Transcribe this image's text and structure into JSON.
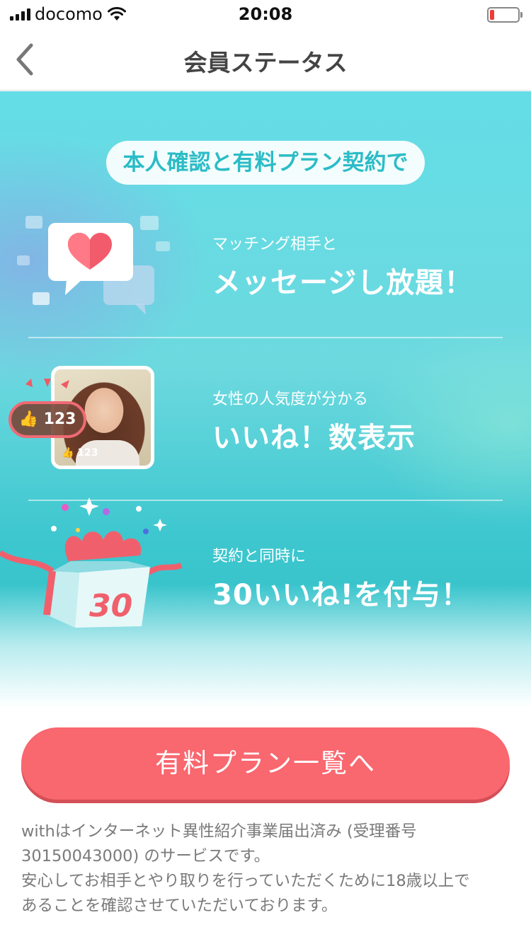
{
  "status_bar": {
    "carrier": "docomo",
    "time": "20:08",
    "battery_level": 0.15,
    "battery_color": "#f03b36"
  },
  "nav": {
    "title": "会員ステータス",
    "back_icon": "chevron-left-icon"
  },
  "hero": {
    "headline": "本人確認と有料プラン契約で",
    "features": [
      {
        "icon": "message-heart-icon",
        "caption": "マッチング相手と",
        "main": "メッセージし放題！"
      },
      {
        "icon": "like-count-photo-icon",
        "caption": "女性の人気度が分かる",
        "main": "いいね！数表示",
        "like_bubble": "123",
        "photo_badge": "123"
      },
      {
        "icon": "gift-box-icon",
        "caption": "契約と同時に",
        "main": "30いいね!を付与！",
        "box_number": "30"
      }
    ]
  },
  "cta": {
    "label": "有料プラン一覧へ",
    "color": "#f9676f"
  },
  "footer": {
    "line1": "withはインターネット異性紹介事業届出済み (受理番号",
    "line2": "30150043000) のサービスです。",
    "line3": "安心してお相手とやり取りを行っていただくために18歳以上で",
    "line4": "あることを確認させていただいております。"
  },
  "colors": {
    "accent_teal": "#2bbcc6",
    "hero_top": "#64dde6",
    "hero_mid": "#39c4cc",
    "cta_pink": "#f9676f"
  }
}
